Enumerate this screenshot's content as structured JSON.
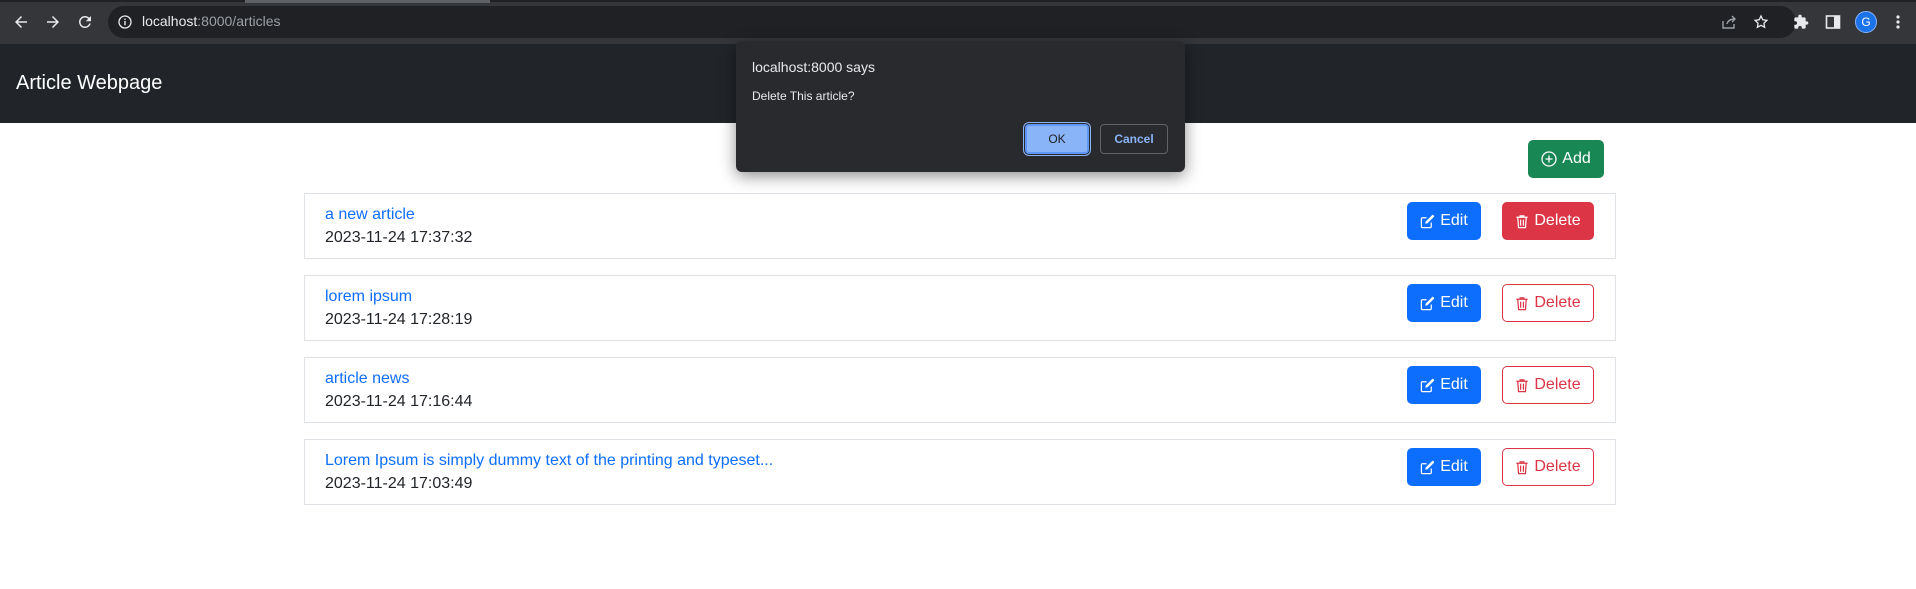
{
  "browser": {
    "url_host": "localhost",
    "url_path": ":8000/articles"
  },
  "navbar": {
    "brand": "Article Webpage"
  },
  "actions": {
    "add_label": "Add"
  },
  "articles": [
    {
      "title": "a new article",
      "date": "2023-11-24 17:37:32",
      "edit_label": "Edit",
      "delete_label": "Delete"
    },
    {
      "title": "lorem ipsum",
      "date": "2023-11-24 17:28:19",
      "edit_label": "Edit",
      "delete_label": "Delete"
    },
    {
      "title": "article news",
      "date": "2023-11-24 17:16:44",
      "edit_label": "Edit",
      "delete_label": "Delete"
    },
    {
      "title": "Lorem Ipsum is simply dummy text of the printing and typeset...",
      "date": "2023-11-24 17:03:49",
      "edit_label": "Edit",
      "delete_label": "Delete"
    }
  ],
  "dialog": {
    "title": "localhost:8000 says",
    "message": "Delete This article?",
    "ok_label": "OK",
    "cancel_label": "Cancel"
  },
  "profile": {
    "initial": "G"
  },
  "icons": {
    "back": "arrow-left-icon",
    "forward": "arrow-right-icon",
    "reload": "reload-icon",
    "info": "info-icon",
    "share": "share-icon",
    "bookmark": "star-icon",
    "extensions": "puzzle-icon",
    "side_panel": "side-panel-icon",
    "menu": "kebab-menu-icon",
    "add": "plus-circle-icon",
    "edit": "pencil-square-icon",
    "delete": "trash-icon"
  },
  "colors": {
    "primary": "#0d6efd",
    "success": "#198754",
    "danger": "#dc3545",
    "navbar_bg": "#212529",
    "dialog_bg": "#292a2d"
  }
}
